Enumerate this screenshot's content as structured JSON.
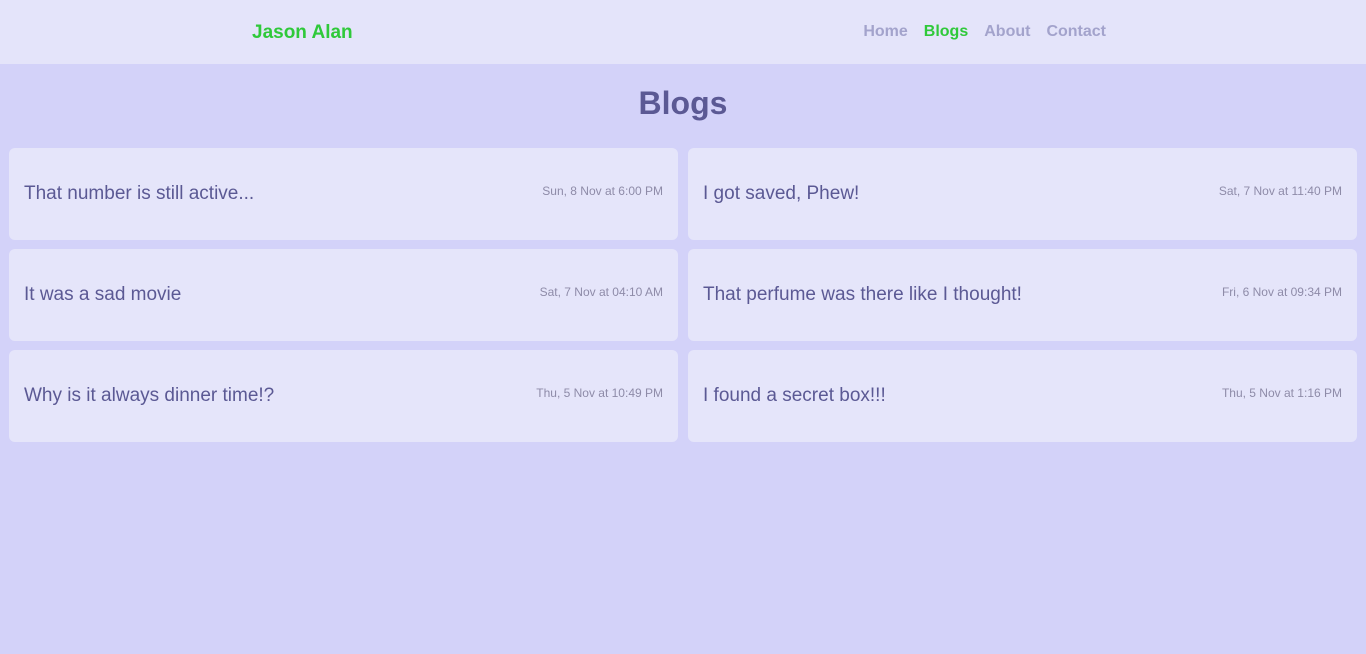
{
  "header": {
    "brand": "Jason Alan",
    "nav": [
      {
        "label": "Home",
        "active": false
      },
      {
        "label": "Blogs",
        "active": true
      },
      {
        "label": "About",
        "active": false
      },
      {
        "label": "Contact",
        "active": false
      }
    ]
  },
  "main": {
    "title": "Blogs",
    "posts": [
      {
        "title": "That number is still active...",
        "date": "Sun, 8 Nov at 6:00 PM"
      },
      {
        "title": "I got saved, Phew!",
        "date": "Sat, 7 Nov at 11:40 PM"
      },
      {
        "title": "It was a sad movie",
        "date": "Sat, 7 Nov at 04:10 AM"
      },
      {
        "title": "That perfume was there like I thought!",
        "date": "Fri, 6 Nov at 09:34 PM"
      },
      {
        "title": "Why is it always dinner time!?",
        "date": "Thu, 5 Nov at 10:49 PM"
      },
      {
        "title": "I found a secret box!!!",
        "date": "Thu, 5 Nov at 1:16 PM"
      }
    ]
  },
  "colors": {
    "background": "#d3d2f9",
    "header_background": "#e4e4fa",
    "card_background": "#e5e5fa",
    "accent_green": "#2fc93a",
    "nav_inactive": "#a3a3cc",
    "title_text": "#5b5994",
    "date_text": "#8e8ba8"
  }
}
